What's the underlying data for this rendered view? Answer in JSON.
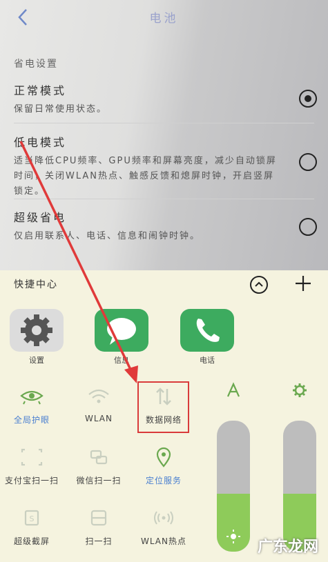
{
  "header": {
    "title": "电池"
  },
  "battery": {
    "section_label": "省电设置",
    "options": [
      {
        "title": "正常模式",
        "desc": "保留日常使用状态。",
        "selected": true
      },
      {
        "title": "低电模式",
        "desc": "适当降低CPU频率、GPU频率和屏幕亮度，减少自动锁屏时间，关闭WLAN热点、触感反馈和熄屏时钟，开启竖屏锁定。",
        "selected": false
      },
      {
        "title": "超级省电",
        "desc": "仅启用联系人、电话、信息和闹钟时钟。",
        "selected": false
      }
    ]
  },
  "quick": {
    "title": "快捷中心",
    "apps": [
      {
        "label": "设置"
      },
      {
        "label": "信息"
      },
      {
        "label": "电话"
      }
    ],
    "tiles": [
      {
        "label": "全局护眼",
        "icon": "eye-icon",
        "active": true
      },
      {
        "label": "WLAN",
        "icon": "wifi-icon",
        "active": false
      },
      {
        "label": "数据网络",
        "icon": "data-arrows-icon",
        "active": false
      },
      {
        "label": "支付宝扫一扫",
        "icon": "scan-icon",
        "active": false
      },
      {
        "label": "微信扫一扫",
        "icon": "wechat-scan-icon",
        "active": false
      },
      {
        "label": "定位服务",
        "icon": "location-icon",
        "active": true
      },
      {
        "label": "超级截屏",
        "icon": "screenshot-icon",
        "active": false
      },
      {
        "label": "扫一扫",
        "icon": "scan-frame-icon",
        "active": false
      },
      {
        "label": "WLAN热点",
        "icon": "hotspot-icon",
        "active": false
      }
    ],
    "brightness_level": 0.44,
    "volume_level": 0.44
  },
  "watermark": "广东龙网",
  "colors": {
    "accent_blue": "#4a7fd0",
    "accent_green": "#6aa84f",
    "highlight_red": "#d93a3a"
  }
}
